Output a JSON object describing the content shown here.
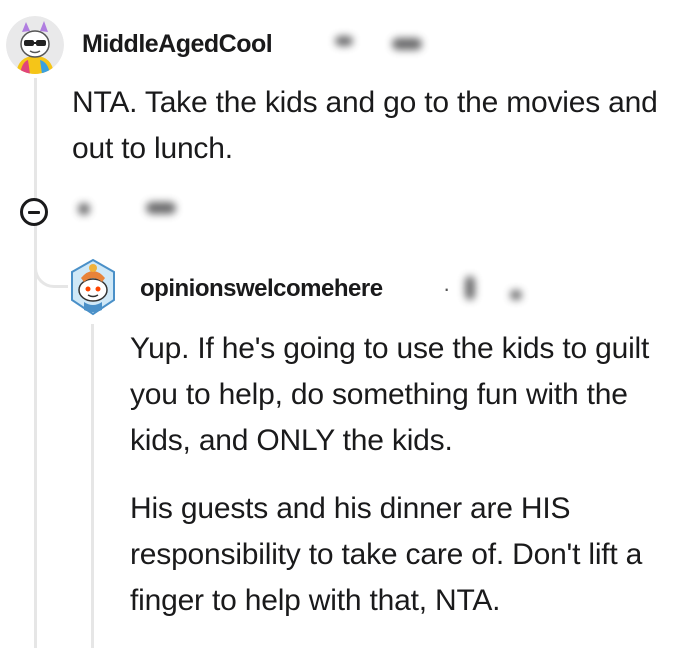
{
  "comment": {
    "username": "MiddleAgedCool",
    "text": "NTA. Take the kids and go to the movies and out to lunch.",
    "avatar_icon": "avatar-icon"
  },
  "collapse": {
    "icon": "collapse-minus-icon"
  },
  "reply": {
    "username": "opinionswelcomehere",
    "separator": "·",
    "avatar_icon": "avatar-icon",
    "paragraphs": [
      "Yup. If he's going to use the kids to guilt you to help, do something fun with the kids, and ONLY the kids.",
      "His guests and his dinner are HIS responsibility to take care of. Don't lift a finger to help with that, NTA."
    ]
  },
  "colors": {
    "text": "#1a1a1b",
    "thread_line": "#e6e6e6"
  }
}
